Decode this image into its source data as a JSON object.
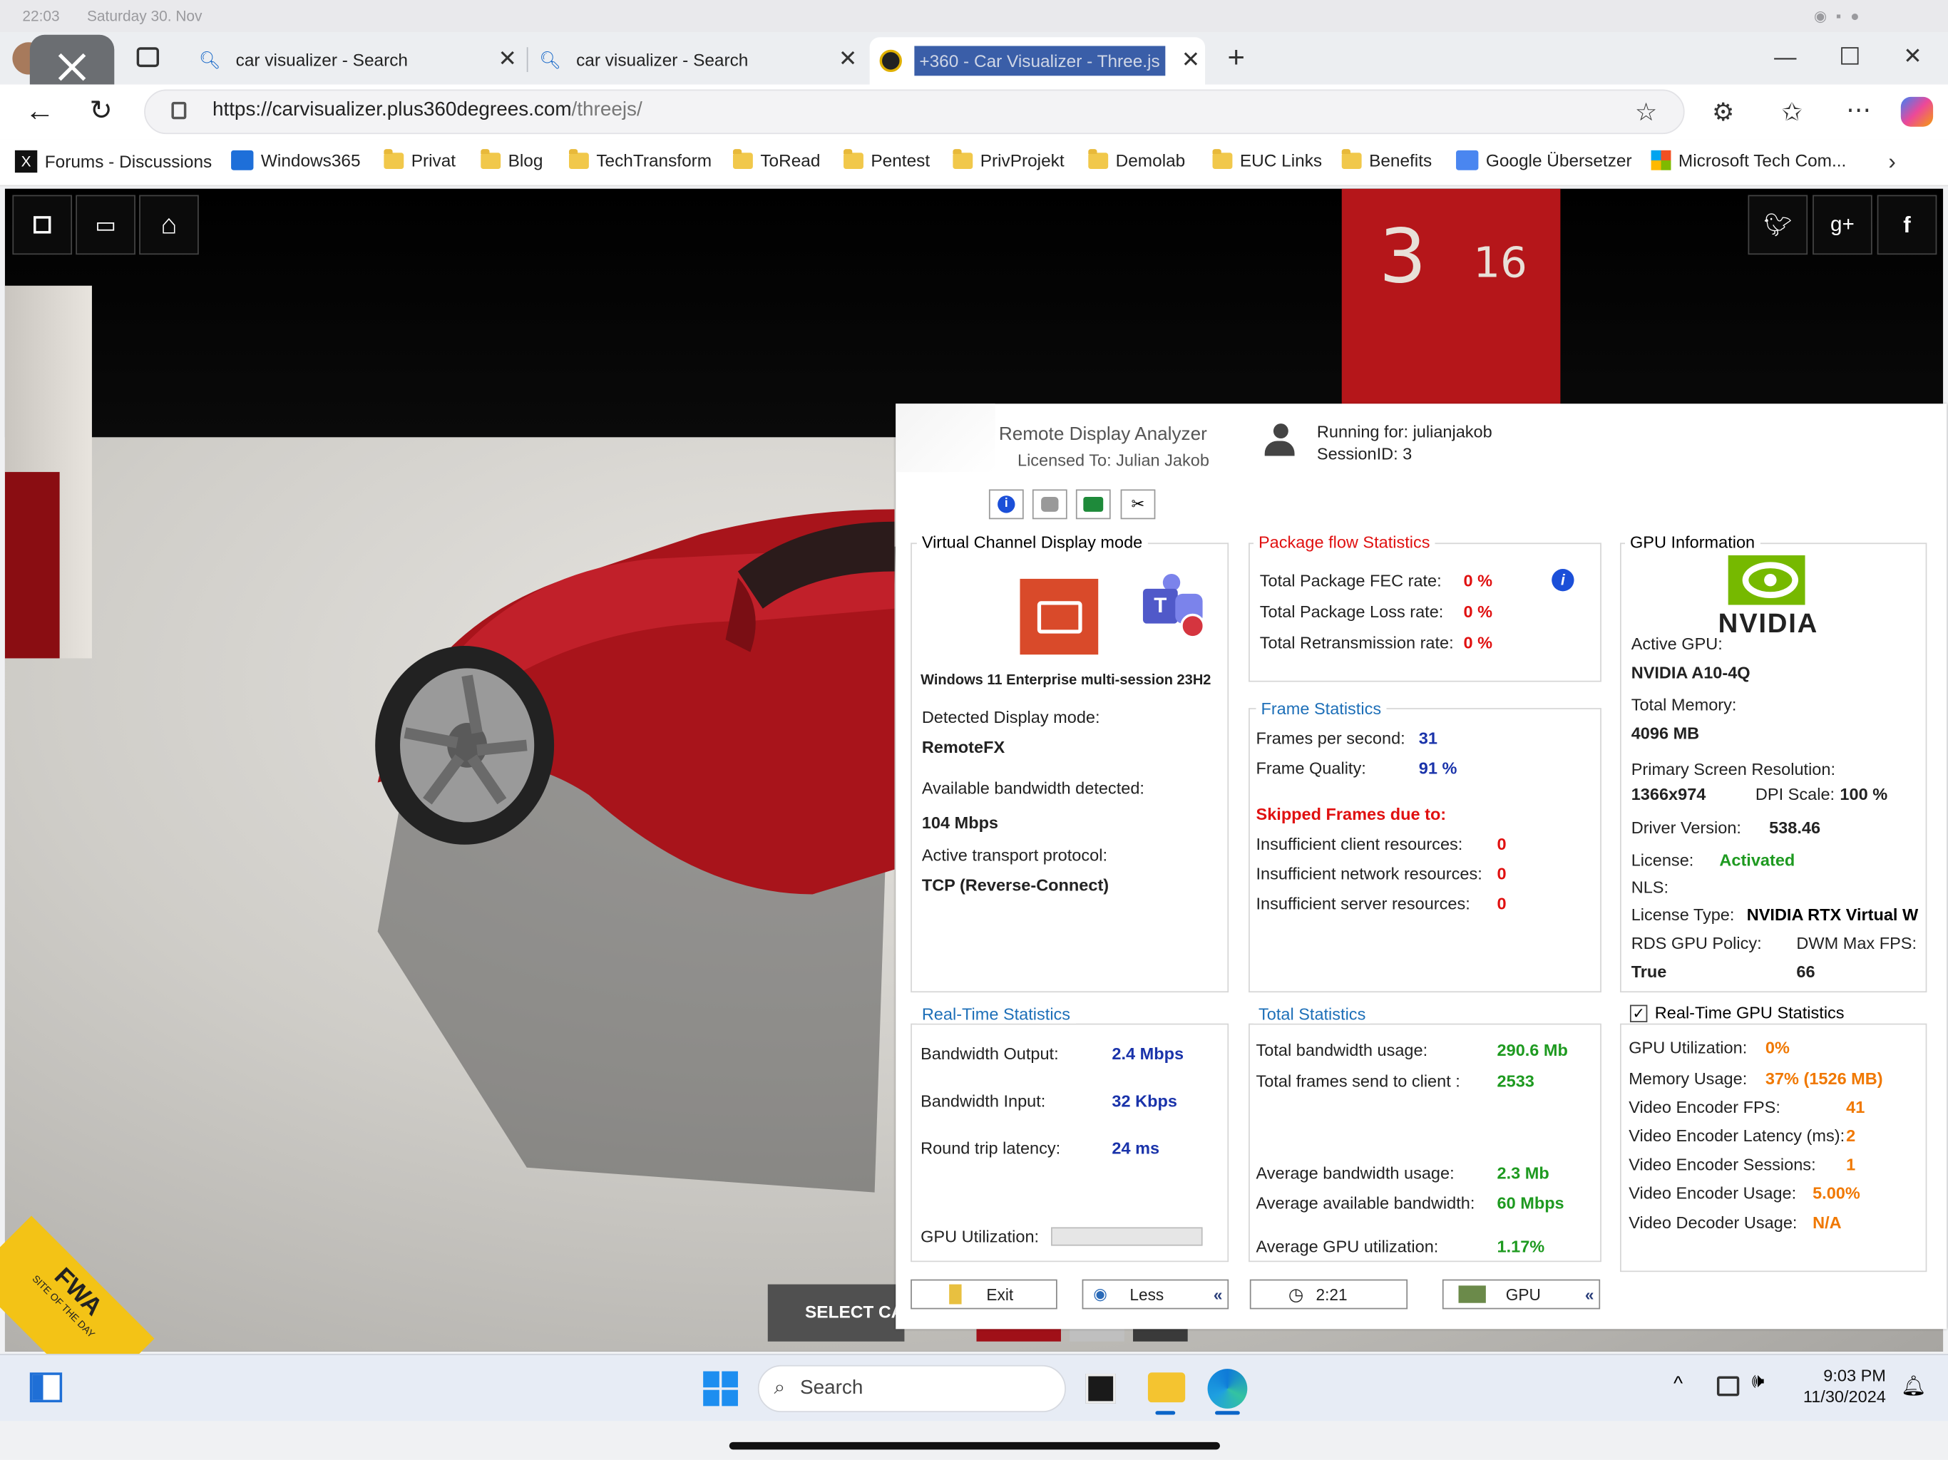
{
  "status_bar": {
    "time": "22:03",
    "date": "Saturday 30. Nov"
  },
  "tabs": [
    {
      "title": "car visualizer - Search",
      "active": false
    },
    {
      "title": "car visualizer - Search",
      "active": false
    },
    {
      "title": "+360 - Car Visualizer - Three.js",
      "active": true
    }
  ],
  "address": {
    "url_host": "https://carvisualizer.plus360degrees.com",
    "url_path": "/threejs/"
  },
  "bookmarks": [
    "Forums - Discussions",
    "Windows365",
    "Privat",
    "Blog",
    "TechTransform",
    "ToRead",
    "Pentest",
    "PrivProjekt",
    "Demolab",
    "EUC Links",
    "Benefits",
    "Google Übersetzer",
    "Microsoft Tech Com..."
  ],
  "page": {
    "select_car": "SELECT CAR M",
    "badge_line1": "FWA",
    "badge_line2": "SITE OF THE DAY",
    "pillar_num1": "3",
    "pillar_num2": "16"
  },
  "rda": {
    "app_title": "Remote Display Analyzer",
    "licensed": "Licensed To: Julian Jakob",
    "running_for": "Running for: julianjakob",
    "session": "SessionID: 3",
    "vc": {
      "title": "Virtual Channel Display mode",
      "os": "Windows 11 Enterprise multi-session 23H2",
      "mode_label": "Detected Display mode:",
      "mode": "RemoteFX",
      "bw_label": "Available bandwidth detected:",
      "bw": "104 Mbps",
      "proto_label": "Active transport protocol:",
      "proto": "TCP (Reverse-Connect)"
    },
    "pkg": {
      "title": "Package flow Statistics",
      "fec_label": "Total Package FEC rate:",
      "fec": "0 %",
      "loss_label": "Total Package Loss rate:",
      "loss": "0 %",
      "retx_label": "Total Retransmission rate:",
      "retx": "0 %"
    },
    "frame": {
      "title": "Frame Statistics",
      "fps_label": "Frames per second:",
      "fps": "31",
      "q_label": "Frame Quality:",
      "q": "91 %",
      "skipped": "Skipped Frames due to:",
      "client_label": "Insufficient client resources:",
      "client": "0",
      "net_label": "Insufficient network resources:",
      "net": "0",
      "server_label": "Insufficient server resources:",
      "server": "0"
    },
    "gpu": {
      "title": "GPU Information",
      "brand": "NVIDIA",
      "active_label": "Active GPU:",
      "active": "NVIDIA A10-4Q",
      "mem_label": "Total Memory:",
      "mem": "4096 MB",
      "res_label": "Primary Screen Resolution:",
      "res": "1366x974",
      "dpi_label": "DPI Scale:",
      "dpi": "100 %",
      "driver_label": "Driver Version:",
      "driver": "538.46",
      "license_label": "License:",
      "license": "Activated",
      "nls_label": "NLS:",
      "ltype_label": "License Type:",
      "ltype": "NVIDIA RTX Virtual W",
      "policy_label": "RDS GPU Policy:",
      "policy": "True",
      "dwm_label": "DWM Max FPS:",
      "dwm": "66"
    },
    "rt": {
      "title": "Real-Time Statistics",
      "out_label": "Bandwidth Output:",
      "out": "2.4 Mbps",
      "in_label": "Bandwidth Input:",
      "in": "32 Kbps",
      "rtt_label": "Round trip latency:",
      "rtt": "24 ms",
      "gpu_label": "GPU Utilization:",
      "gpu_fraction": 0
    },
    "total": {
      "title": "Total Statistics",
      "bw_label": "Total bandwidth usage:",
      "bw": "290.6 Mb",
      "frames_label": "Total frames send to client :",
      "frames": "2533",
      "avgbw_label": "Average bandwidth usage:",
      "avgbw": "2.3 Mb",
      "avail_label": "Average available bandwidth:",
      "avail": "60 Mbps",
      "avggpu_label": "Average GPU utilization:",
      "avggpu": "1.17%"
    },
    "rtgpu": {
      "title": "Real-Time GPU Statistics",
      "checked": true,
      "util_label": "GPU Utilization:",
      "util": "0%",
      "mem_label": "Memory Usage:",
      "mem": "37% (1526 MB)",
      "encfps_label": "Video Encoder FPS:",
      "encfps": "41",
      "enclat_label": "Video Encoder Latency (ms):",
      "enclat": "2",
      "encsess_label": "Video Encoder Sessions:",
      "encsess": "1",
      "encuse_label": "Video Encoder Usage:",
      "encuse": "5.00%",
      "decuse_label": "Video Decoder Usage:",
      "decuse": "N/A"
    },
    "buttons": {
      "exit": "Exit",
      "less": "Less",
      "time": "2:21",
      "gpu": "GPU"
    }
  },
  "taskbar": {
    "search": "Search",
    "time": "9:03 PM",
    "date": "11/30/2024"
  },
  "colors": {
    "brand_nvidia": "#76b900",
    "rda_red": "#e01010",
    "rda_blue": "#1a33aa",
    "rda_green": "#1e9a20",
    "rda_orange": "#f07800",
    "car_red": "#a8141b"
  }
}
